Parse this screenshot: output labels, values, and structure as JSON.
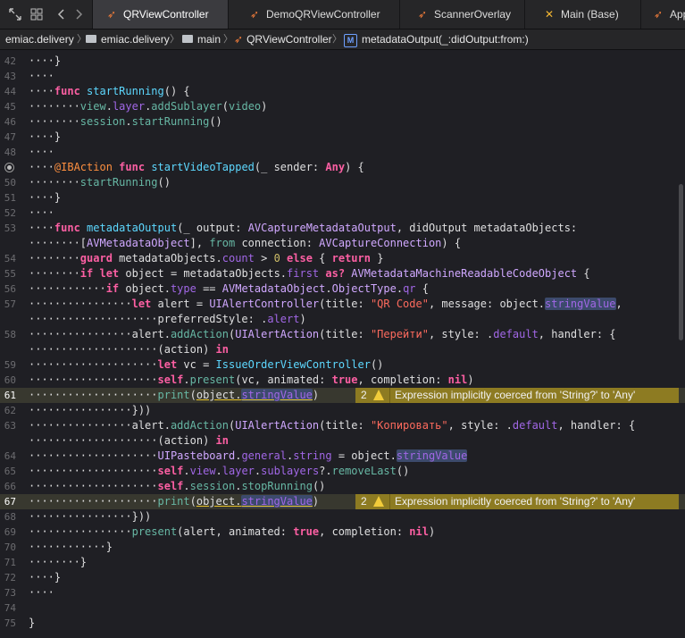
{
  "tabs": [
    {
      "label": "QRViewController",
      "icon": "swift-icon",
      "active": true
    },
    {
      "label": "DemoQRViewController",
      "icon": "swift-icon",
      "active": false
    },
    {
      "label": "ScannerOverlay",
      "icon": "swift-icon",
      "active": false
    },
    {
      "label": "Main (Base)",
      "icon": "storyboard-icon",
      "active": false
    },
    {
      "label": "App",
      "icon": "swift-icon",
      "active": false
    }
  ],
  "breadcrumb": [
    "emiac.delivery",
    "emiac.delivery",
    "main",
    "QRViewController",
    "metadataOutput(_:didOutput:from:)"
  ],
  "breadcrumb_method_badge": "M",
  "line_numbers": {
    "l42": "42",
    "l43": "43",
    "l44": "44",
    "l45": "45",
    "l46": "46",
    "l47": "47",
    "l48": "48",
    "l50": "50",
    "l51": "51",
    "l52": "52",
    "l53": "53",
    "l54": "54",
    "l55": "55",
    "l56": "56",
    "l57": "57",
    "l58": "58",
    "l59": "59",
    "l60": "60",
    "l61": "61",
    "l62": "62",
    "l63": "63",
    "l64": "64",
    "l65": "65",
    "l66": "66",
    "l67": "67",
    "l68": "68",
    "l69": "69",
    "l70": "70",
    "l71": "71",
    "l72": "72",
    "l73": "73",
    "l74": "74",
    "l75": "75"
  },
  "warnings": [
    {
      "line": "61",
      "count": "2",
      "message": "Expression implicitly coerced from 'String?' to 'Any'"
    },
    {
      "line": "67",
      "count": "2",
      "message": "Expression implicitly coerced from 'String?' to 'Any'"
    }
  ],
  "colors": {
    "keyword": "#fc5fa3",
    "type": "#d0a8ff",
    "function": "#67b7a4",
    "string": "#fc6a5d",
    "warning_bg": "#8d7b22"
  }
}
